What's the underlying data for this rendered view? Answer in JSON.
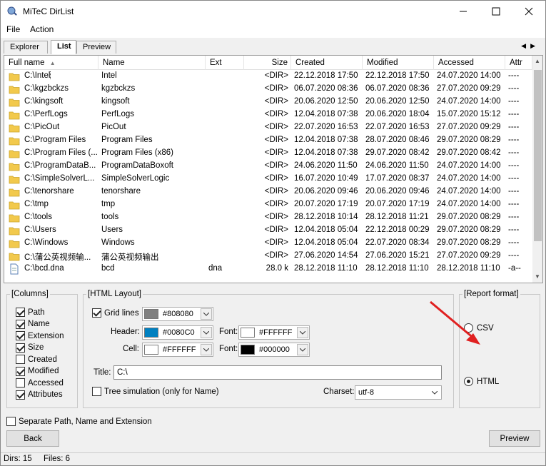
{
  "window": {
    "title": "MiTeC DirList"
  },
  "menu": [
    "File",
    "Action"
  ],
  "tabs": [
    "Explorer",
    "List",
    "Preview"
  ],
  "columns": [
    "Full name",
    "Name",
    "Ext",
    "Size",
    "Created",
    "Modified",
    "Accessed",
    "Attr"
  ],
  "rows": [
    {
      "type": "folder",
      "full": "C:\\Intel",
      "name": "Intel",
      "ext": "",
      "size": "<DIR>",
      "created": "22.12.2018 17:50",
      "modified": "22.12.2018 17:50",
      "accessed": "24.07.2020 14:00",
      "attr": "----"
    },
    {
      "type": "folder",
      "full": "C:\\kgzbckzs",
      "name": "kgzbckzs",
      "ext": "",
      "size": "<DIR>",
      "created": "06.07.2020 08:36",
      "modified": "06.07.2020 08:36",
      "accessed": "27.07.2020 09:29",
      "attr": "----"
    },
    {
      "type": "folder",
      "full": "C:\\kingsoft",
      "name": "kingsoft",
      "ext": "",
      "size": "<DIR>",
      "created": "20.06.2020 12:50",
      "modified": "20.06.2020 12:50",
      "accessed": "24.07.2020 14:00",
      "attr": "----"
    },
    {
      "type": "folder",
      "full": "C:\\PerfLogs",
      "name": "PerfLogs",
      "ext": "",
      "size": "<DIR>",
      "created": "12.04.2018 07:38",
      "modified": "20.06.2020 18:04",
      "accessed": "15.07.2020 15:12",
      "attr": "----"
    },
    {
      "type": "folder",
      "full": "C:\\PicOut",
      "name": "PicOut",
      "ext": "",
      "size": "<DIR>",
      "created": "22.07.2020 16:53",
      "modified": "22.07.2020 16:53",
      "accessed": "27.07.2020 09:29",
      "attr": "----"
    },
    {
      "type": "folder",
      "full": "C:\\Program Files",
      "name": "Program Files",
      "ext": "",
      "size": "<DIR>",
      "created": "12.04.2018 07:38",
      "modified": "28.07.2020 08:46",
      "accessed": "29.07.2020 08:29",
      "attr": "----"
    },
    {
      "type": "folder",
      "full": "C:\\Program Files (...",
      "name": "Program Files (x86)",
      "ext": "",
      "size": "<DIR>",
      "created": "12.04.2018 07:38",
      "modified": "29.07.2020 08:42",
      "accessed": "29.07.2020 08:42",
      "attr": "----"
    },
    {
      "type": "folder",
      "full": "C:\\ProgramDataB...",
      "name": "ProgramDataBoxoft",
      "ext": "",
      "size": "<DIR>",
      "created": "24.06.2020 11:50",
      "modified": "24.06.2020 11:50",
      "accessed": "24.07.2020 14:00",
      "attr": "----"
    },
    {
      "type": "folder",
      "full": "C:\\SimpleSolverL...",
      "name": "SimpleSolverLogic",
      "ext": "",
      "size": "<DIR>",
      "created": "16.07.2020 10:49",
      "modified": "17.07.2020 08:37",
      "accessed": "24.07.2020 14:00",
      "attr": "----"
    },
    {
      "type": "folder",
      "full": "C:\\tenorshare",
      "name": "tenorshare",
      "ext": "",
      "size": "<DIR>",
      "created": "20.06.2020 09:46",
      "modified": "20.06.2020 09:46",
      "accessed": "24.07.2020 14:00",
      "attr": "----"
    },
    {
      "type": "folder",
      "full": "C:\\tmp",
      "name": "tmp",
      "ext": "",
      "size": "<DIR>",
      "created": "20.07.2020 17:19",
      "modified": "20.07.2020 17:19",
      "accessed": "24.07.2020 14:00",
      "attr": "----"
    },
    {
      "type": "folder",
      "full": "C:\\tools",
      "name": "tools",
      "ext": "",
      "size": "<DIR>",
      "created": "28.12.2018 10:14",
      "modified": "28.12.2018 11:21",
      "accessed": "29.07.2020 08:29",
      "attr": "----"
    },
    {
      "type": "folder",
      "full": "C:\\Users",
      "name": "Users",
      "ext": "",
      "size": "<DIR>",
      "created": "12.04.2018 05:04",
      "modified": "22.12.2018 00:29",
      "accessed": "29.07.2020 08:29",
      "attr": "----"
    },
    {
      "type": "folder",
      "full": "C:\\Windows",
      "name": "Windows",
      "ext": "",
      "size": "<DIR>",
      "created": "12.04.2018 05:04",
      "modified": "22.07.2020 08:34",
      "accessed": "29.07.2020 08:29",
      "attr": "----"
    },
    {
      "type": "folder",
      "full": "C:\\蒲公英视频输...",
      "name": "蒲公英视频输出",
      "ext": "",
      "size": "<DIR>",
      "created": "27.06.2020 14:54",
      "modified": "27.06.2020 15:21",
      "accessed": "27.07.2020 09:29",
      "attr": "----"
    },
    {
      "type": "file",
      "full": "C:\\bcd.dna",
      "name": "bcd",
      "ext": "dna",
      "size": "28.0 k",
      "created": "28.12.2018 11:10",
      "modified": "28.12.2018 11:10",
      "accessed": "28.12.2018 11:10",
      "attr": "-a--"
    }
  ],
  "columns_group": {
    "title": "[Columns]",
    "items": [
      {
        "label": "Path",
        "checked": true
      },
      {
        "label": "Name",
        "checked": true
      },
      {
        "label": "Extension",
        "checked": true
      },
      {
        "label": "Size",
        "checked": true
      },
      {
        "label": "Created",
        "checked": false
      },
      {
        "label": "Modified",
        "checked": true
      },
      {
        "label": "Accessed",
        "checked": false
      },
      {
        "label": "Attributes",
        "checked": true
      }
    ]
  },
  "html_layout": {
    "title": "[HTML Layout]",
    "grid_lines_label": "Grid lines",
    "grid_color": "#808080",
    "header_label": "Header:",
    "header_color": "#0080C0",
    "header_font_label": "Font:",
    "header_font_color": "#FFFFFF",
    "cell_label": "Cell:",
    "cell_color": "#FFFFFF",
    "cell_font_label": "Font:",
    "cell_font_color": "#000000",
    "title_label": "Title:",
    "title_value": "C:\\",
    "tree_label": "Tree simulation (only for Name)",
    "charset_label": "Charset:",
    "charset_value": "utf-8"
  },
  "report_format": {
    "title": "[Report format]",
    "csv_label": "CSV",
    "html_label": "HTML",
    "selected": "HTML"
  },
  "separate_label": "Separate Path, Name and Extension",
  "buttons": {
    "back": "Back",
    "preview": "Preview"
  },
  "status": {
    "dirs": "Dirs: 15",
    "files": "Files: 6"
  },
  "colors": {
    "folder": "#f2c94c",
    "annotation": "#e02020"
  }
}
